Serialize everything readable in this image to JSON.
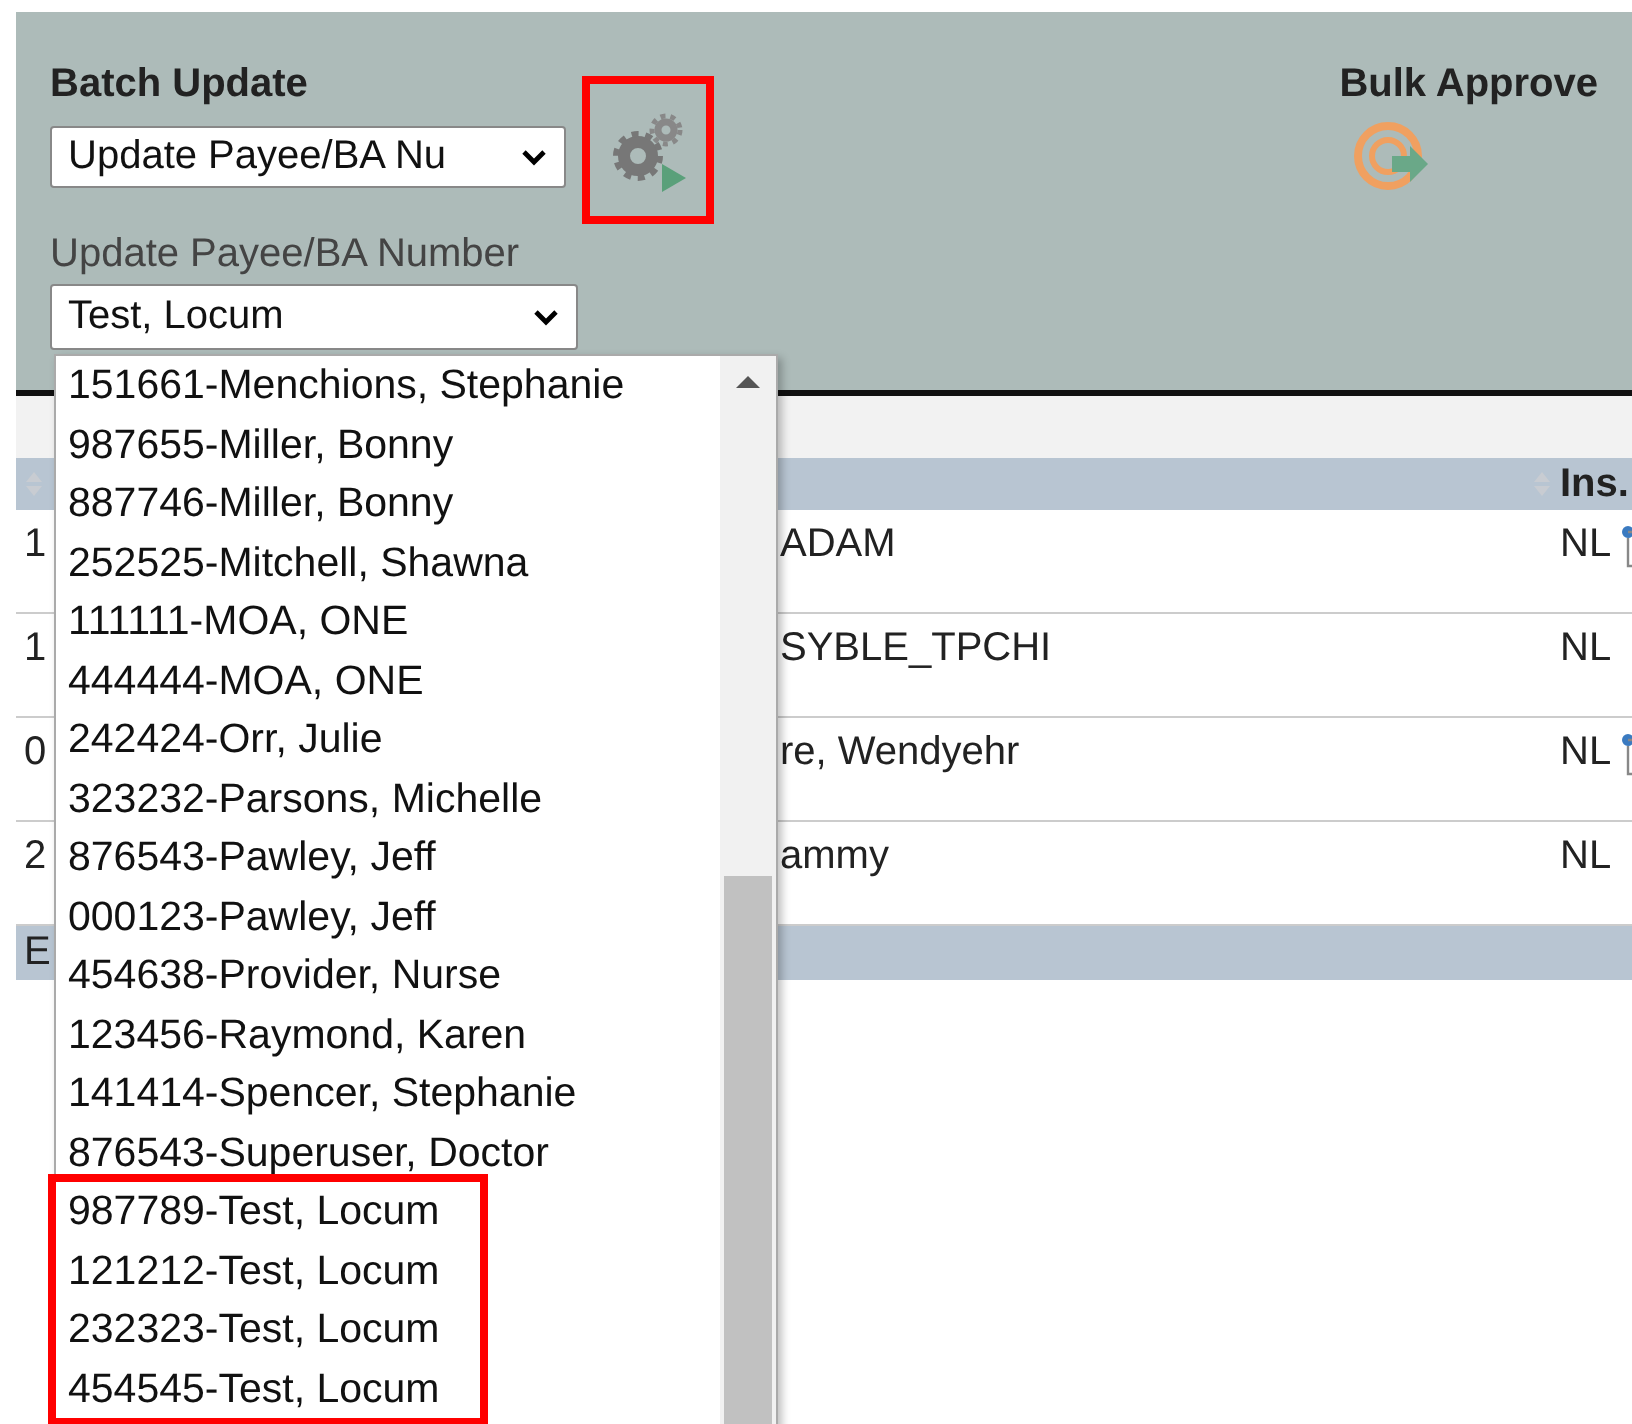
{
  "batch_update": {
    "title": "Batch Update",
    "action_select": {
      "value": "Update Payee/BA Nu"
    },
    "run_button": {
      "highlighted": true
    },
    "field_label": "Update Payee/BA Number",
    "payee_select": {
      "value": "Test, Locum"
    }
  },
  "bulk_approve": {
    "title": "Bulk Approve"
  },
  "payee_options": [
    {
      "label": "151661-Menchions, Stephanie",
      "highlighted": false
    },
    {
      "label": "987655-Miller, Bonny",
      "highlighted": false
    },
    {
      "label": "887746-Miller, Bonny",
      "highlighted": false
    },
    {
      "label": "252525-Mitchell, Shawna",
      "highlighted": false
    },
    {
      "label": "111111-MOA, ONE",
      "highlighted": false
    },
    {
      "label": "444444-MOA, ONE",
      "highlighted": false
    },
    {
      "label": "242424-Orr, Julie",
      "highlighted": false
    },
    {
      "label": "323232-Parsons, Michelle",
      "highlighted": false
    },
    {
      "label": "876543-Pawley, Jeff",
      "highlighted": false
    },
    {
      "label": "000123-Pawley, Jeff",
      "highlighted": false
    },
    {
      "label": "454638-Provider, Nurse",
      "highlighted": false
    },
    {
      "label": "123456-Raymond, Karen",
      "highlighted": false
    },
    {
      "label": "141414-Spencer, Stephanie",
      "highlighted": false
    },
    {
      "label": "876543-Superuser, Doctor",
      "highlighted": false
    },
    {
      "label": "987789-Test, Locum",
      "highlighted": true
    },
    {
      "label": "121212-Test, Locum",
      "highlighted": true
    },
    {
      "label": "232323-Test, Locum",
      "highlighted": true
    },
    {
      "label": "454545-Test, Locum",
      "highlighted": true
    }
  ],
  "table": {
    "columns": [
      {},
      {},
      {
        "label": "Ins."
      }
    ],
    "rows": [
      {
        "column_1": "1",
        "column_2": "ADAM",
        "ins": "NL",
        "note_icon": true
      },
      {
        "column_1": "1",
        "column_2": "SYBLE_TPCHI",
        "ins": "NL",
        "note_icon": false
      },
      {
        "column_1": "0",
        "column_2": "re, Wendyehr",
        "ins": "NL",
        "note_icon": true
      },
      {
        "column_1": "2",
        "column_2": "ammy",
        "ins": "NL",
        "note_icon": false
      }
    ],
    "footer": "E"
  }
}
